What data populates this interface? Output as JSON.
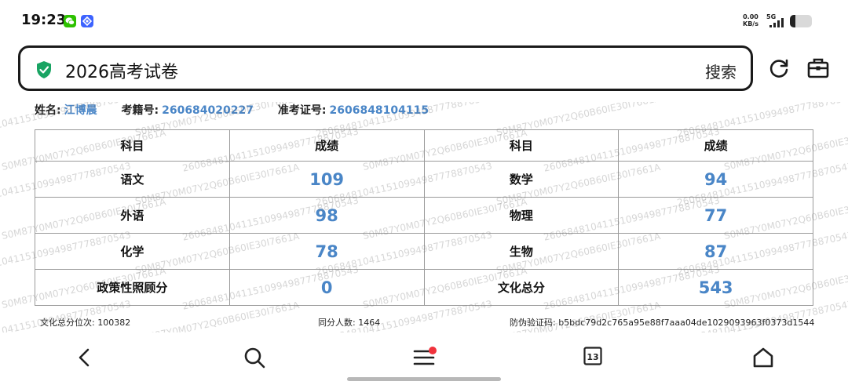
{
  "status_bar": {
    "time": "19:23",
    "net_speed_value": "0.00",
    "net_speed_unit": "KB/s",
    "network_type": "5G",
    "battery_level": 0.25,
    "wechat_color": "#2dc100",
    "app_color": "#3d63ff"
  },
  "search_bar": {
    "query": "2026高考试卷",
    "search_label": "搜索",
    "shield_color": "#19a463"
  },
  "candidate": {
    "name_label": "姓名:",
    "name": "江博晨",
    "roll_label": "考籍号:",
    "roll": "260684020227",
    "exam_label": "准考证号:",
    "exam": "2606848104115"
  },
  "table": {
    "headers": [
      "科目",
      "成绩",
      "科目",
      "成绩"
    ],
    "rows": [
      {
        "s1": "语文",
        "g1": "109",
        "s2": "数学",
        "g2": "94"
      },
      {
        "s1": "外语",
        "g1": "98",
        "s2": "物理",
        "g2": "77"
      },
      {
        "s1": "化学",
        "g1": "78",
        "s2": "生物",
        "g2": "87"
      },
      {
        "s1": "政策性照顾分",
        "g1": "0",
        "s2": "文化总分",
        "g2": "543"
      }
    ]
  },
  "footer": {
    "rank": "文化总分位次:  100382",
    "same_score": "同分人数:  1464",
    "verify": "防伪验证码:  b5bdc79d2c765a95e88f7aaa04de1029093963f0373d1544"
  },
  "watermark": {
    "line1": "2606848104115109949877788705 43",
    "line2": "S0M87Y0M07Y2Q60B60IE30I7661A"
  },
  "nav": {
    "calendar_day": "13",
    "accent_color": "#f0323c"
  }
}
